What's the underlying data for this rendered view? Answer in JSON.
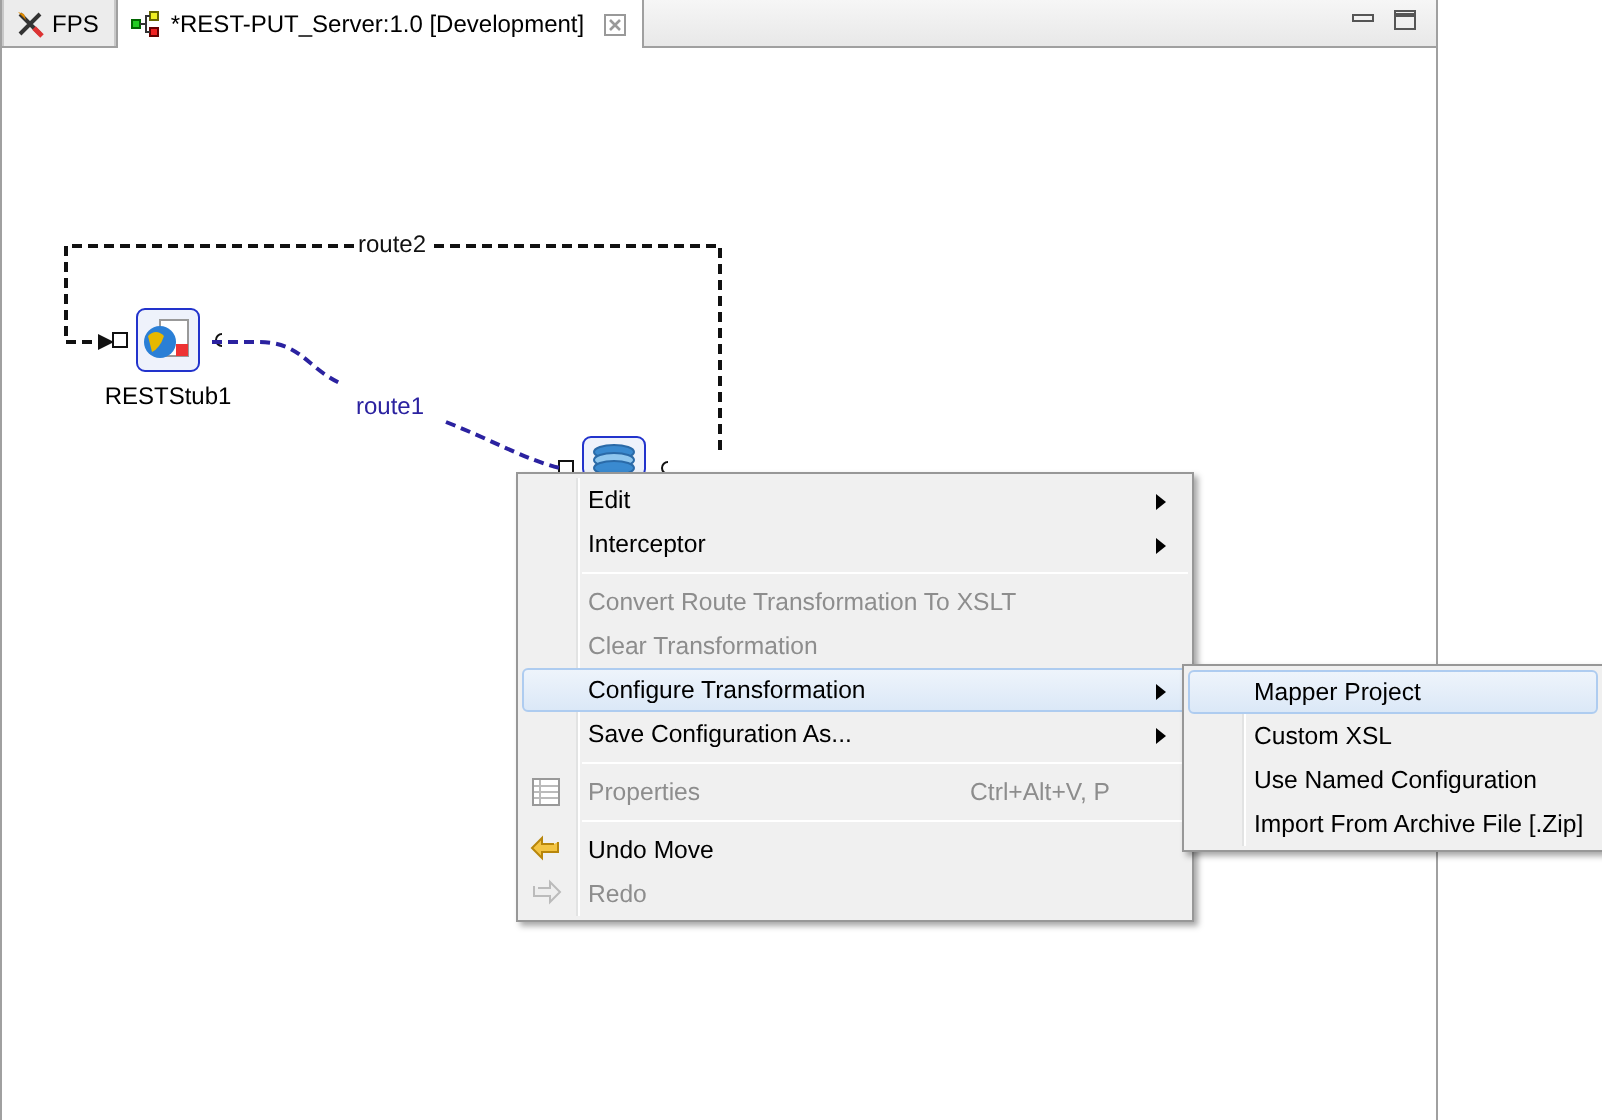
{
  "tabs": [
    {
      "label": "FPS",
      "kind": "tools",
      "selected": false,
      "closable": false
    },
    {
      "label": "*REST-PUT_Server:1.0 [Development]",
      "kind": "diagram",
      "selected": true,
      "closable": true
    }
  ],
  "diagram": {
    "nodes": [
      {
        "kind": "rest-stub",
        "label": "RESTStub1"
      },
      {
        "kind": "database"
      }
    ],
    "routes": [
      {
        "label": "route2",
        "color": "#111111"
      },
      {
        "label": "route1",
        "color": "#2b22a0"
      }
    ]
  },
  "context_menu": {
    "items": [
      {
        "kind": "item",
        "label": "Edit",
        "disabled": false,
        "selected": false,
        "submenu": true
      },
      {
        "kind": "item",
        "label": "Interceptor",
        "disabled": false,
        "selected": false,
        "submenu": true
      },
      {
        "kind": "separator"
      },
      {
        "kind": "item",
        "label": "Convert Route Transformation To XSLT",
        "disabled": true,
        "selected": false,
        "submenu": false
      },
      {
        "kind": "item",
        "label": "Clear Transformation",
        "disabled": true,
        "selected": false,
        "submenu": false
      },
      {
        "kind": "item",
        "label": "Configure Transformation",
        "disabled": false,
        "selected": true,
        "submenu": true
      },
      {
        "kind": "item",
        "label": "Save Configuration As...",
        "disabled": false,
        "selected": false,
        "submenu": true
      },
      {
        "kind": "separator"
      },
      {
        "label": "Properties",
        "disabled": true,
        "selected": false,
        "submenu": false,
        "shortcut": "Ctrl+Alt+V, P",
        "kind": "properties"
      },
      {
        "kind": "separator"
      },
      {
        "kind": "undo",
        "label": "Undo Move",
        "disabled": false,
        "selected": false,
        "submenu": false
      },
      {
        "kind": "redo",
        "label": "Redo",
        "disabled": true,
        "selected": false,
        "submenu": false
      }
    ]
  },
  "submenu": {
    "items": [
      {
        "label": "Mapper Project",
        "selected": true
      },
      {
        "label": "Custom XSL",
        "selected": false
      },
      {
        "label": "Use Named Configuration",
        "selected": false
      },
      {
        "label": "Import From Archive File [.Zip]",
        "selected": false
      }
    ]
  }
}
